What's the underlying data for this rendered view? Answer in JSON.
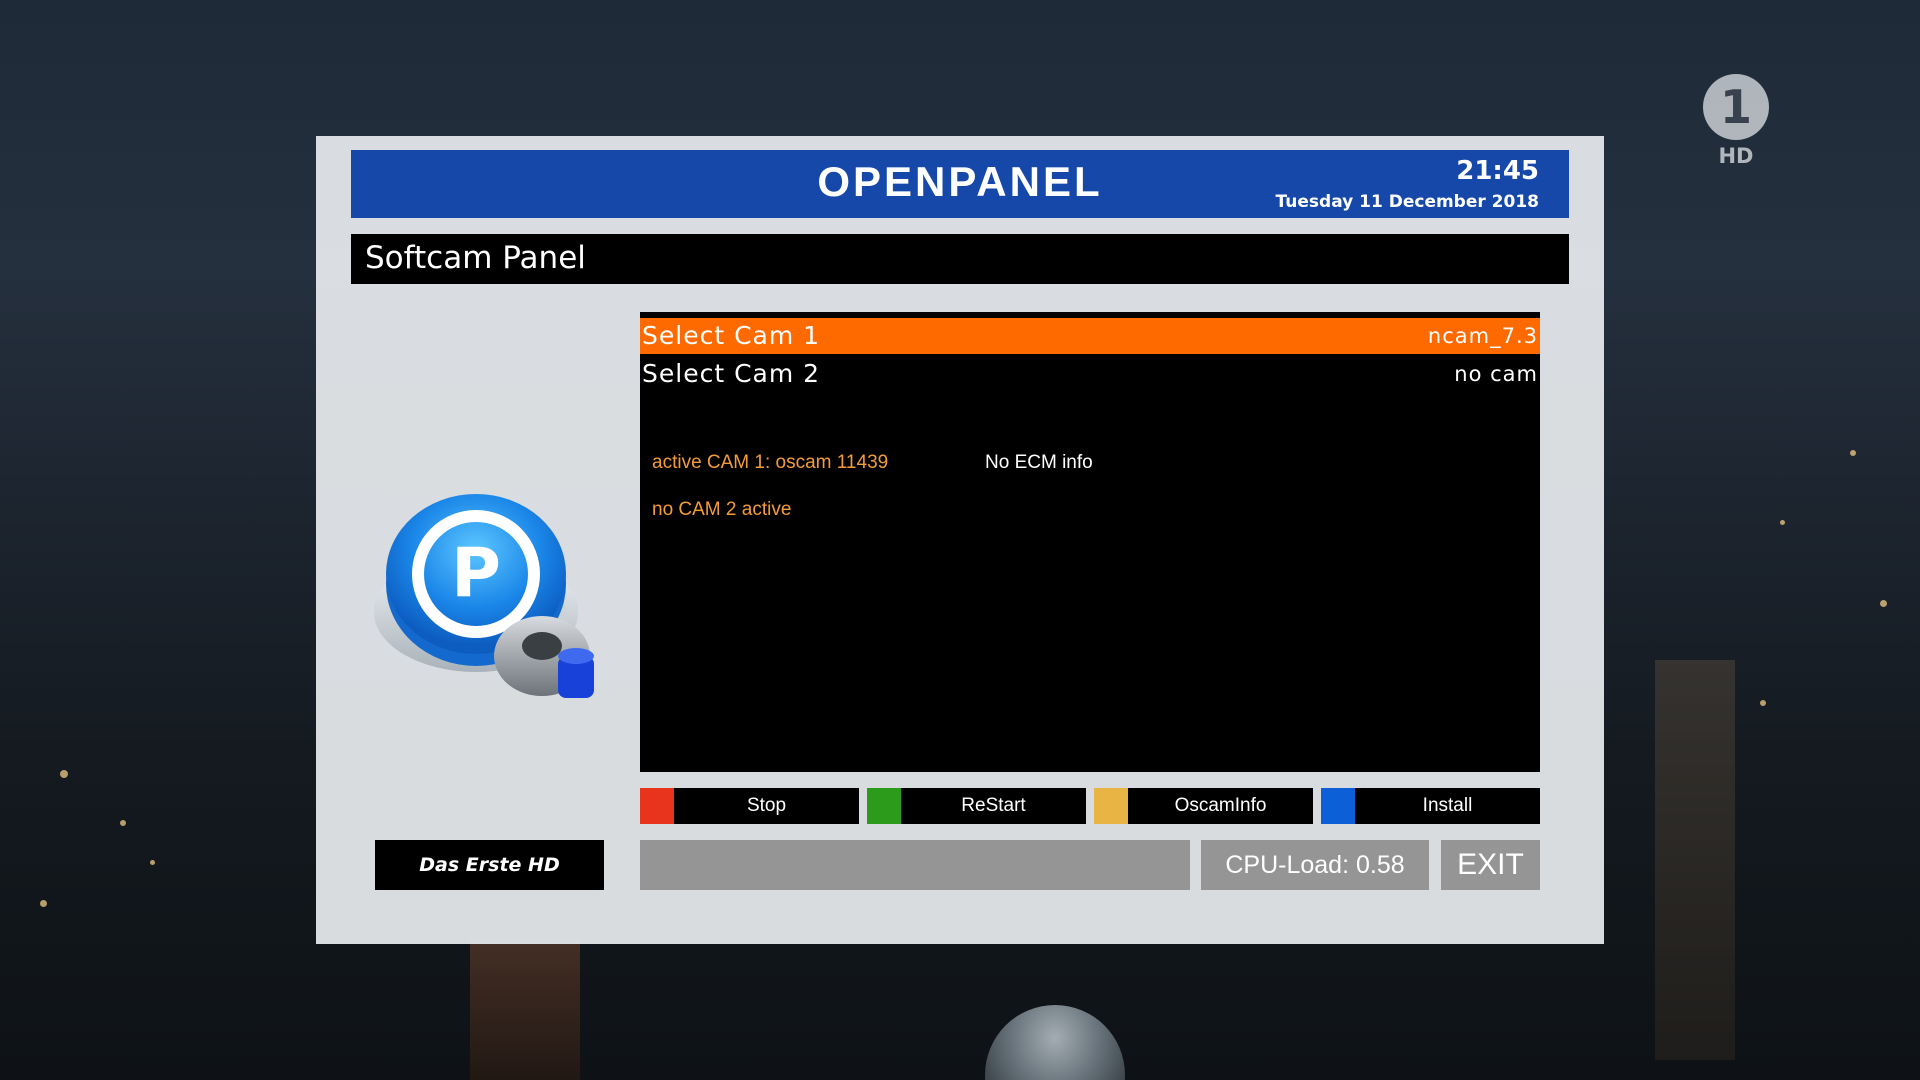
{
  "channel_logo": {
    "symbol": "1",
    "label": "HD"
  },
  "header": {
    "title": "OPENPANEL",
    "time": "21:45",
    "date": "Tuesday 11 December 2018"
  },
  "subtitle": "Softcam Panel",
  "cams": [
    {
      "label": "Select Cam 1",
      "value": "ncam_7.3",
      "selected": true
    },
    {
      "label": "Select Cam 2",
      "value": "no cam",
      "selected": false
    }
  ],
  "info": {
    "active_cam1": "active CAM 1: oscam 11439",
    "ecm": "No ECM info",
    "cam2": "no CAM 2 active"
  },
  "buttons": [
    {
      "label": "Stop",
      "color": "#e8341c"
    },
    {
      "label": "ReStart",
      "color": "#2c9a1a"
    },
    {
      "label": "OscamInfo",
      "color": "#e8b545"
    },
    {
      "label": "Install",
      "color": "#0d5fd8"
    }
  ],
  "channel_name": "Das Erste HD",
  "cpu_load": "CPU-Load: 0.58",
  "exit_label": "EXIT",
  "colors": {
    "header_blue": "#1548a8",
    "selection_orange": "#ff6a00",
    "info_orange": "#f39c3a"
  }
}
